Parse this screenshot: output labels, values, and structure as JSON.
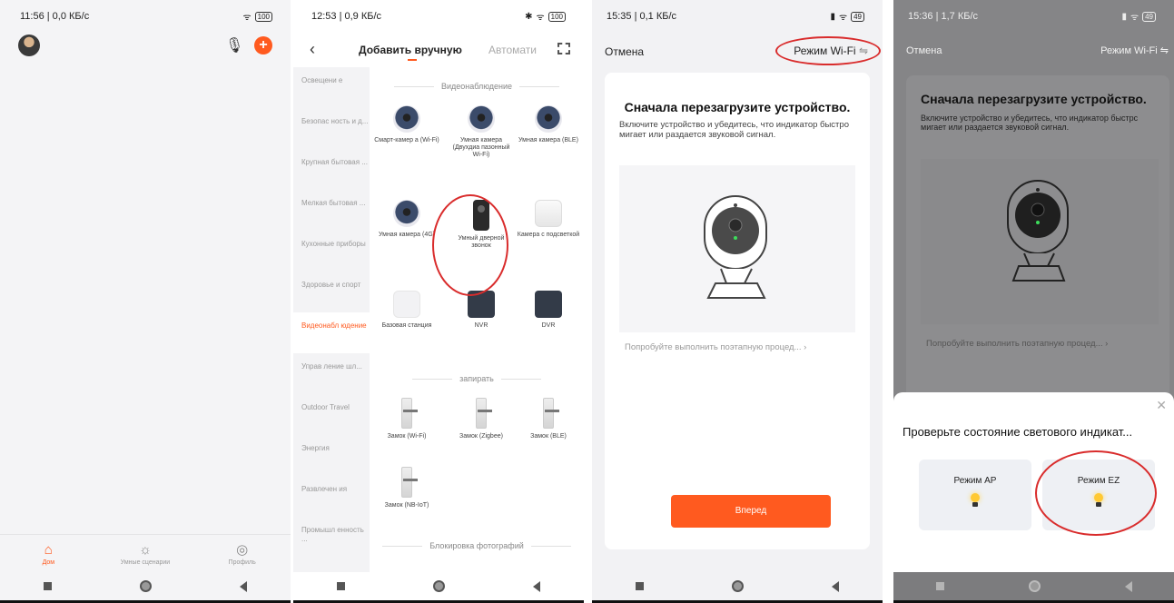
{
  "panel1": {
    "status_time": "11:56 | 0,0 КБ/с",
    "battery": "100",
    "tabs": [
      {
        "label": "Дом",
        "icon": "home-icon"
      },
      {
        "label": "Умные сценарии",
        "icon": "sun-icon"
      },
      {
        "label": "Профиль",
        "icon": "profile-icon"
      }
    ]
  },
  "panel2": {
    "status_time": "12:53 | 0,9 КБ/с",
    "battery": "100",
    "title": "Добавить вручную",
    "auto_tab": "Автомати",
    "categories": [
      "Освещени е",
      "Безопас ность и д...",
      "Крупная бытовая ...",
      "Мелкая бытовая ...",
      "Кухонные приборы",
      "Здоровье и спорт",
      "Видеонабл юдение",
      "Управ ление шл...",
      "Outdoor Travel",
      "Энергия",
      "Развлечен ия",
      "Промышл енность ..."
    ],
    "sections": [
      "Видеонаблюдение",
      "запирать",
      "Блокировка фотографий"
    ],
    "devices": [
      "Смарт-камер а (Wi-Fi)",
      "Умная камера (Двухдиа пазонный Wi-Fi)",
      "Умная камера (BLE)",
      "Умная камера (4G)",
      "Умный дверной звонок",
      "Камера с подсветкой",
      "Базовая станция",
      "NVR",
      "DVR",
      "Замок (Wi-Fi)",
      "Замок (Zigbee)",
      "Замок (BLE)",
      "Замок (NB-IoT)"
    ]
  },
  "panel3": {
    "status_time": "15:35 | 0,1 КБ/с",
    "battery": "49",
    "cancel": "Отмена",
    "mode": "Режим Wi-Fi",
    "heading": "Сначала перезагрузите устройство.",
    "description": "Включите устройство и убедитесь, что индикатор быстро мигает или раздается звуковой сигнал.",
    "try_link": "Попробуйте выполнить поэтапную процед...",
    "next_button": "Вперед"
  },
  "panel4": {
    "status_time": "15:36 | 1,7 КБ/с",
    "battery": "49",
    "cancel": "Отмена",
    "mode": "Режим Wi-Fi",
    "heading": "Сначала перезагрузите устройство.",
    "description": "Включите устройство и убедитесь, что индикатор быстрс мигает или раздается звуковой сигнал.",
    "try_link": "Попробуйте выполнить поэтапную процед...",
    "sheet_title": "Проверьте состояние светового индикат...",
    "mode_ap": "Режим AP",
    "mode_ez": "Режим EZ"
  },
  "colors": {
    "accent": "#ff5a1f",
    "highlight_ring": "#d92c2c"
  }
}
